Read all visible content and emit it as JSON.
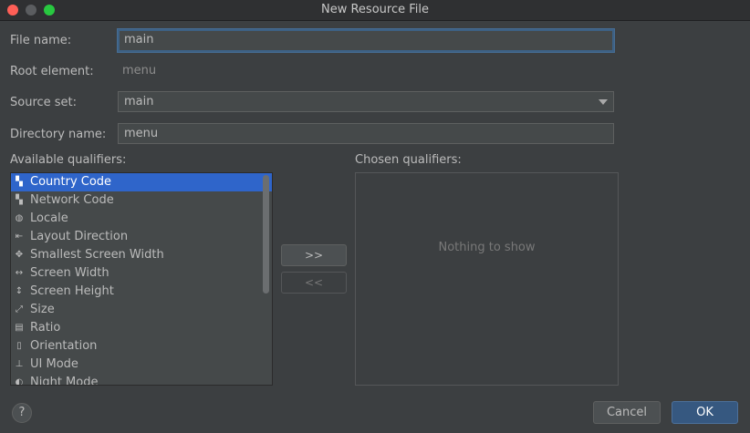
{
  "window": {
    "title": "New Resource File"
  },
  "form": {
    "file_name_label": "File name:",
    "file_name_value": "main",
    "root_element_label": "Root element:",
    "root_element_value": "menu",
    "source_set_label": "Source set:",
    "source_set_value": "main",
    "directory_name_label": "Directory name:",
    "directory_name_value": "menu"
  },
  "available": {
    "label": "Available qualifiers:",
    "items": [
      {
        "label": "Country Code",
        "icon": "country-code-icon",
        "glyph": "▚"
      },
      {
        "label": "Network Code",
        "icon": "network-code-icon",
        "glyph": "▚"
      },
      {
        "label": "Locale",
        "icon": "globe-icon",
        "glyph": "◍"
      },
      {
        "label": "Layout Direction",
        "icon": "layout-direction-icon",
        "glyph": "⇤"
      },
      {
        "label": "Smallest Screen Width",
        "icon": "smallest-width-icon",
        "glyph": "✥"
      },
      {
        "label": "Screen Width",
        "icon": "screen-width-icon",
        "glyph": "↔"
      },
      {
        "label": "Screen Height",
        "icon": "screen-height-icon",
        "glyph": "↕"
      },
      {
        "label": "Size",
        "icon": "size-icon",
        "glyph": "⤢"
      },
      {
        "label": "Ratio",
        "icon": "ratio-icon",
        "glyph": "▤"
      },
      {
        "label": "Orientation",
        "icon": "orientation-icon",
        "glyph": "▯"
      },
      {
        "label": "UI Mode",
        "icon": "ui-mode-icon",
        "glyph": "⊥"
      },
      {
        "label": "Night Mode",
        "icon": "night-mode-icon",
        "glyph": "◐"
      }
    ],
    "selected_index": 0
  },
  "chosen": {
    "label": "Chosen qualifiers:",
    "empty_text": "Nothing to show"
  },
  "buttons": {
    "add": ">>",
    "remove": "<<",
    "cancel": "Cancel",
    "ok": "OK",
    "help": "?"
  },
  "colors": {
    "background": "#3c3f41",
    "selection": "#2f65ca",
    "primary_button": "#365880"
  }
}
